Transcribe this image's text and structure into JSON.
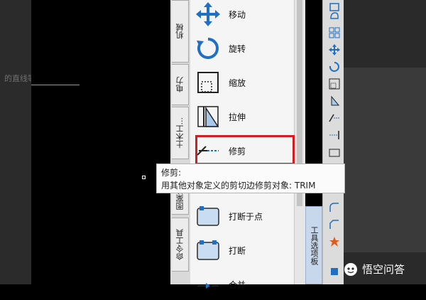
{
  "canvas": {
    "partial_label": "的直线等"
  },
  "tabs": [
    {
      "label": "机械"
    },
    {
      "label": "电力"
    },
    {
      "label": "土木工..."
    },
    {
      "label": "图案填..."
    },
    {
      "label": "命令工具"
    }
  ],
  "tools": [
    {
      "label": "移动",
      "icon": "move-icon"
    },
    {
      "label": "旋转",
      "icon": "rotate-icon"
    },
    {
      "label": "缩放",
      "icon": "scale-icon"
    },
    {
      "label": "拉伸",
      "icon": "stretch-icon"
    },
    {
      "label": "修剪",
      "icon": "trim-icon"
    },
    {
      "label": "打断于点",
      "icon": "break-at-point-icon"
    },
    {
      "label": "打断",
      "icon": "break-icon"
    },
    {
      "label": "合并",
      "icon": "join-icon"
    }
  ],
  "tooltip": {
    "title": "修剪:",
    "description": "用其他对象定义的剪切边修剪对象:  TRIM"
  },
  "side_tab": {
    "label": "工具选项板"
  },
  "watermark": {
    "text": "悟空问答"
  },
  "colors": {
    "highlight": "#d11f1f",
    "icon_blue": "#1f6fc4",
    "side_tab": "#c8d8ec"
  }
}
